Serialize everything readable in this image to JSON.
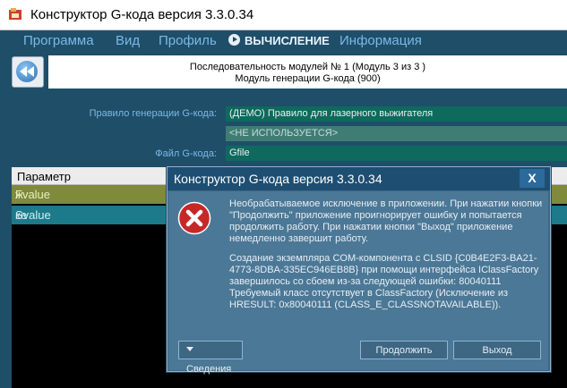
{
  "window": {
    "title": "Конструктор G-кода версия 3.3.0.34"
  },
  "menu": {
    "items": [
      "Программа",
      "Вид",
      "Профиль"
    ],
    "active": "ВЫЧИСЛЕНИЕ",
    "last": "Информация"
  },
  "sequence": {
    "line1": "Последовательность модулей № 1 (Модуль 3 из 3 )",
    "line2": "Модуль генерации G-кода (900)"
  },
  "form": {
    "rule_label": "Правило генерации G-кода:",
    "rule_value": "(ДЕМО) Правило для лазерного выжигателя",
    "unused_value": "<НЕ ИСПОЛЬЗУЕТСЯ>",
    "file_label": "Файл G-кода:",
    "file_value": "Gfile"
  },
  "grid": {
    "header": "Параметр",
    "rows": [
      {
        "name": "Fvalue",
        "tail": "ж"
      },
      {
        "name": "Svalue",
        "tail": "ке"
      }
    ]
  },
  "dialog": {
    "title": "Конструктор G-кода версия 3.3.0.34",
    "close": "X",
    "message1": "Необрабатываемое исключение в приложении. При нажатии кнопки \"Продолжить\" приложение проигнорирует ошибку и попытается продолжить работу. При нажатии кнопки \"Выход\" приложение немедленно завершит работу.",
    "message2": "Создание экземпляра COM-компонента с CLSID {C0B4E2F3-BA21-4773-8DBA-335EC946EB8B} при помощи интерфейса IClassFactory завершилось со сбоем из-за следующей ошибки: 80040111 Требуемый класс отсутствует в ClassFactory (Исключение из HRESULT: 0x80040111 (CLASS_E_CLASSNOTAVAILABLE)).",
    "details_button": "Сведения",
    "continue_button": "Продолжить",
    "exit_button": "Выход"
  },
  "colors": {
    "background": "#1f4e69",
    "menu_text": "#7ab9e6",
    "field_bg": "#0e6a5c",
    "dialog_bg": "#4b7896"
  },
  "icons": [
    "app-icon",
    "play-icon",
    "back-double-arrow-icon",
    "error-icon",
    "triangle-down-icon"
  ]
}
